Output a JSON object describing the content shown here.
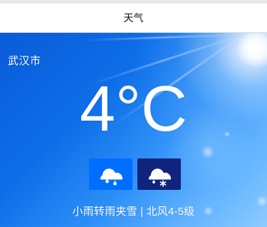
{
  "header": {
    "title": "天气"
  },
  "weather": {
    "city": "武汉市",
    "temperature": "4°C",
    "description": "小雨转雨夹雪 | 北风4-5级",
    "icons": [
      {
        "name": "light-rain-icon"
      },
      {
        "name": "sleet-icon"
      }
    ]
  },
  "colors": {
    "page_top": "#e9e9e9",
    "title_background": "#ffffff",
    "sky_blue": "#0e6ee8",
    "icon_box_1": "#006eff",
    "icon_box_2": "#10247d",
    "text_white": "#ffffff"
  }
}
